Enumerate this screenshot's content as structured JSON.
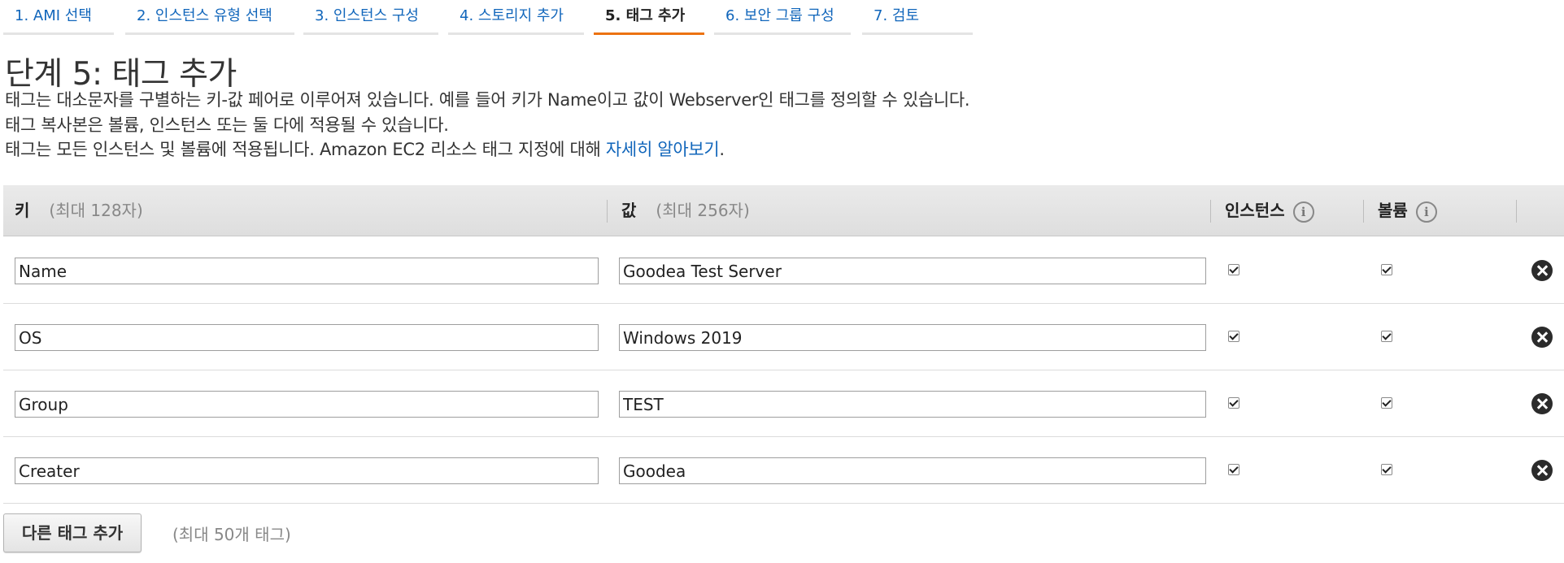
{
  "wizard": {
    "tabs": [
      {
        "label": "1. AMI 선택",
        "active": false
      },
      {
        "label": "2. 인스턴스 유형 선택",
        "active": false
      },
      {
        "label": "3. 인스턴스 구성",
        "active": false
      },
      {
        "label": "4. 스토리지 추가",
        "active": false
      },
      {
        "label": "5. 태그 추가",
        "active": true
      },
      {
        "label": "6. 보안 그룹 구성",
        "active": false
      },
      {
        "label": "7. 검토",
        "active": false
      }
    ]
  },
  "page": {
    "title": "단계 5: 태그 추가",
    "desc1": "태그는 대소문자를 구별하는 키-값 페어로 이루어져 있습니다. 예를 들어 키가 Name이고 값이 Webserver인 태그를 정의할 수 있습니다.",
    "desc2": "태그 복사본은 볼륨, 인스턴스 또는 둘 다에 적용될 수 있습니다.",
    "desc3_text": "태그는 모든 인스턴스 및 볼륨에 적용됩니다. Amazon EC2 리소스 태그 지정에 대해 ",
    "desc3_link": "자세히 알아보기",
    "desc3_end": "."
  },
  "table": {
    "headers": {
      "key": "키",
      "key_hint": "(최대 128자)",
      "value": "값",
      "value_hint": "(최대 256자)",
      "instances": "인스턴스",
      "volumes": "볼륨"
    },
    "rows": [
      {
        "key": "Name",
        "value": "Goodea Test Server",
        "instances": true,
        "volumes": true
      },
      {
        "key": "OS",
        "value": "Windows 2019",
        "instances": true,
        "volumes": true
      },
      {
        "key": "Group",
        "value": "TEST",
        "instances": true,
        "volumes": true
      },
      {
        "key": "Creater",
        "value": "Goodea",
        "instances": true,
        "volumes": true
      }
    ]
  },
  "footer": {
    "add_button": "다른 태그 추가",
    "max_tags": "(최대 50개 태그)"
  },
  "colors": {
    "link": "#1166bb",
    "active_tab": "#ec7211"
  }
}
